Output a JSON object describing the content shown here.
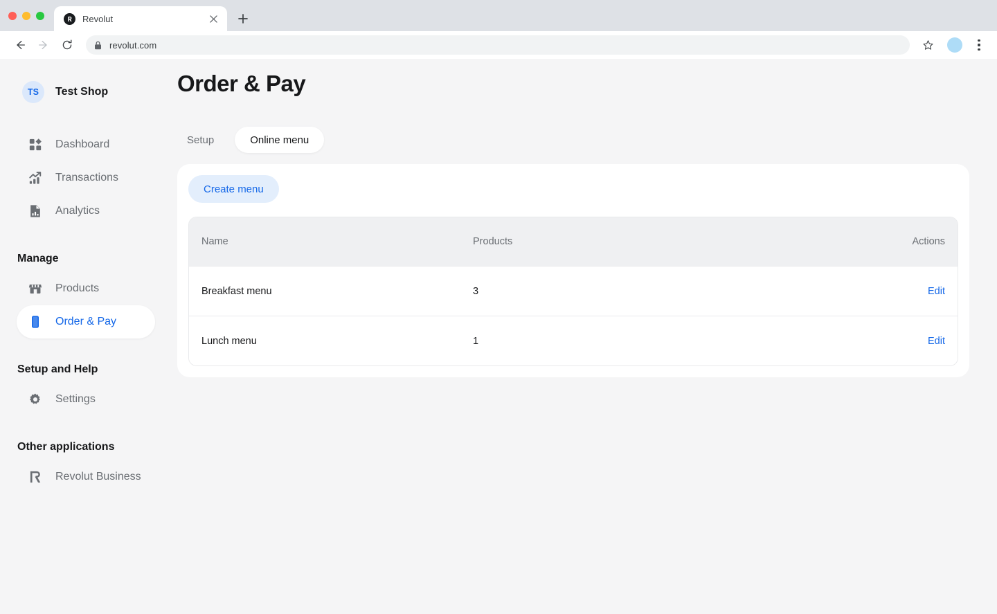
{
  "browser": {
    "tab": {
      "title": "Revolut",
      "favicon_name": "revolut-favicon",
      "close_label": "×"
    },
    "new_tab_label": "+",
    "toolbar": {
      "back_label": "←",
      "forward_label": "→",
      "reload_label": "⟳",
      "lock_name": "lock-icon",
      "url": "revolut.com",
      "star_name": "bookmark-star-icon",
      "profile_name": "profile-avatar",
      "menu_name": "browser-menu-icon"
    }
  },
  "sidebar": {
    "org": {
      "initials": "TS",
      "name": "Test Shop"
    },
    "primary_items": [
      {
        "label": "Dashboard",
        "icon": "grid-icon",
        "active": false
      },
      {
        "label": "Transactions",
        "icon": "chart-arrow-icon",
        "active": false
      },
      {
        "label": "Analytics",
        "icon": "document-bar-icon",
        "active": false
      }
    ],
    "manage": {
      "title": "Manage",
      "items": [
        {
          "label": "Products",
          "icon": "storefront-icon",
          "active": false
        },
        {
          "label": "Order & Pay",
          "icon": "phone-icon",
          "active": true
        }
      ]
    },
    "setup_help": {
      "title": "Setup and Help",
      "items": [
        {
          "label": "Settings",
          "icon": "gear-icon",
          "active": false
        }
      ]
    },
    "other_applications": {
      "title": "Other applications",
      "items": [
        {
          "label": "Revolut Business",
          "icon": "revolut-r-icon",
          "active": false
        }
      ]
    }
  },
  "main": {
    "page_title": "Order & Pay",
    "tabs": [
      {
        "label": "Setup",
        "active": false
      },
      {
        "label": "Online menu",
        "active": true
      }
    ],
    "create_button": "Create menu",
    "table": {
      "columns": [
        "Name",
        "Products",
        "Actions"
      ],
      "rows": [
        {
          "name": "Breakfast menu",
          "products": "3",
          "action": "Edit"
        },
        {
          "name": "Lunch menu",
          "products": "1",
          "action": "Edit"
        }
      ]
    }
  },
  "colors": {
    "accent_blue": "#1568e8",
    "page_bg": "#f5f5f6",
    "card_bg": "#ffffff",
    "table_header_bg": "#eff0f2",
    "text_primary": "#17181a",
    "text_muted": "#6a6e73",
    "create_btn_bg": "#e3eefc"
  }
}
